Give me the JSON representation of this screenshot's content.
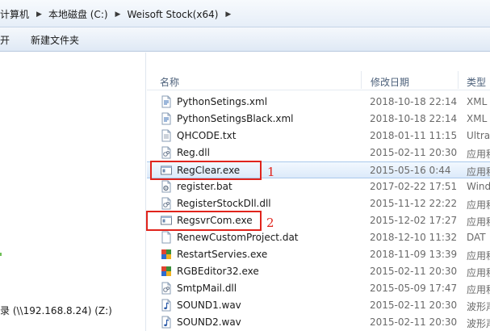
{
  "breadcrumb": [
    "计算机",
    "本地磁盘 (C:)",
    "Weisoft Stock(x64)"
  ],
  "toolbar": {
    "open_label": "开",
    "new_folder_label": "新建文件夹"
  },
  "nav": {
    "drive_label": "录 (\\\\192.168.8.24) (Z:)"
  },
  "columns": {
    "name": "名称",
    "modified": "修改日期",
    "type": "类型"
  },
  "files": [
    {
      "name": "PythonSetings.xml",
      "date": "2018-10-18 22:14",
      "type": "XML",
      "icon": "xml-file-icon"
    },
    {
      "name": "PythonSetingsBlack.xml",
      "date": "2018-10-18 22:14",
      "type": "XML",
      "icon": "xml-file-icon"
    },
    {
      "name": "QHCODE.txt",
      "date": "2018-01-11 11:15",
      "type": "Ultra",
      "icon": "text-file-icon"
    },
    {
      "name": "Reg.dll",
      "date": "2015-02-11 20:30",
      "type": "应用程",
      "icon": "dll-file-icon"
    },
    {
      "name": "RegClear.exe",
      "date": "2015-05-16 0:44",
      "type": "应用程",
      "icon": "exe-file-icon",
      "selected": true
    },
    {
      "name": "register.bat",
      "date": "2017-02-22 17:51",
      "type": "Wind",
      "icon": "bat-file-icon"
    },
    {
      "name": "RegisterStockDll.dll",
      "date": "2015-11-12 22:22",
      "type": "应用程",
      "icon": "dll-file-icon"
    },
    {
      "name": "RegsvrCom.exe",
      "date": "2015-12-02 17:27",
      "type": "应用程",
      "icon": "exe-file-icon"
    },
    {
      "name": "RenewCustomProject.dat",
      "date": "2018-12-10 11:32",
      "type": "DAT",
      "icon": "dat-file-icon"
    },
    {
      "name": "RestartServies.exe",
      "date": "2018-11-09 13:39",
      "type": "应用程",
      "icon": "app-colorful-icon"
    },
    {
      "name": "RGBEditor32.exe",
      "date": "2015-02-11 20:30",
      "type": "应用程",
      "icon": "app-colorful-icon"
    },
    {
      "name": "SmtpMail.dll",
      "date": "2015-05-09 17:47",
      "type": "应用程",
      "icon": "dll-file-icon"
    },
    {
      "name": "SOUND1.wav",
      "date": "2015-02-11 20:30",
      "type": "波形声",
      "icon": "wav-file-icon"
    },
    {
      "name": "SOUND2.wav",
      "date": "2015-02-11 20:30",
      "type": "波形声",
      "icon": "wav-file-icon"
    }
  ],
  "annotations": {
    "first": "1",
    "second": "2",
    "color": "#e0241c"
  }
}
